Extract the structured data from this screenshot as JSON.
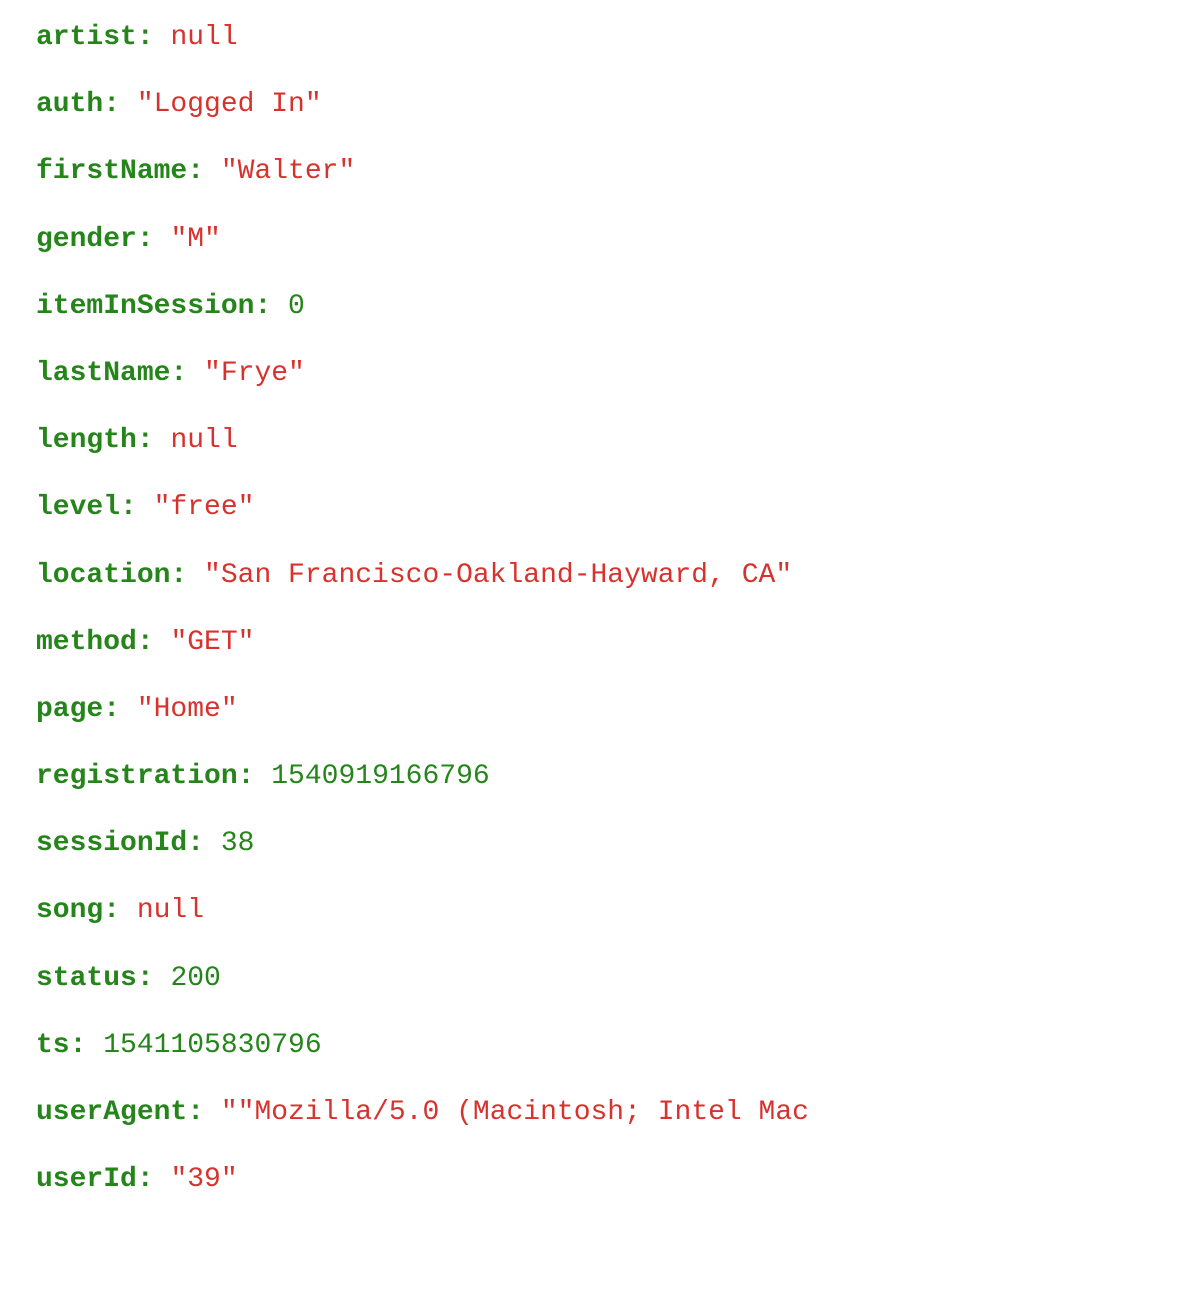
{
  "fields": [
    {
      "key": "artist",
      "type": "null",
      "value": "null"
    },
    {
      "key": "auth",
      "type": "string",
      "value": "\"Logged In\""
    },
    {
      "key": "firstName",
      "type": "string",
      "value": "\"Walter\""
    },
    {
      "key": "gender",
      "type": "string",
      "value": "\"M\""
    },
    {
      "key": "itemInSession",
      "type": "number",
      "value": "0"
    },
    {
      "key": "lastName",
      "type": "string",
      "value": "\"Frye\""
    },
    {
      "key": "length",
      "type": "null",
      "value": "null"
    },
    {
      "key": "level",
      "type": "string",
      "value": "\"free\""
    },
    {
      "key": "location",
      "type": "string",
      "value": "\"San Francisco-Oakland-Hayward, CA\""
    },
    {
      "key": "method",
      "type": "string",
      "value": "\"GET\""
    },
    {
      "key": "page",
      "type": "string",
      "value": "\"Home\""
    },
    {
      "key": "registration",
      "type": "number",
      "value": "1540919166796"
    },
    {
      "key": "sessionId",
      "type": "number",
      "value": "38"
    },
    {
      "key": "song",
      "type": "null",
      "value": "null"
    },
    {
      "key": "status",
      "type": "number",
      "value": "200"
    },
    {
      "key": "ts",
      "type": "number",
      "value": "1541105830796"
    },
    {
      "key": "userAgent",
      "type": "string",
      "value": "\"\"Mozilla/5.0 (Macintosh; Intel Mac"
    },
    {
      "key": "userId",
      "type": "string",
      "value": "\"39\""
    }
  ]
}
